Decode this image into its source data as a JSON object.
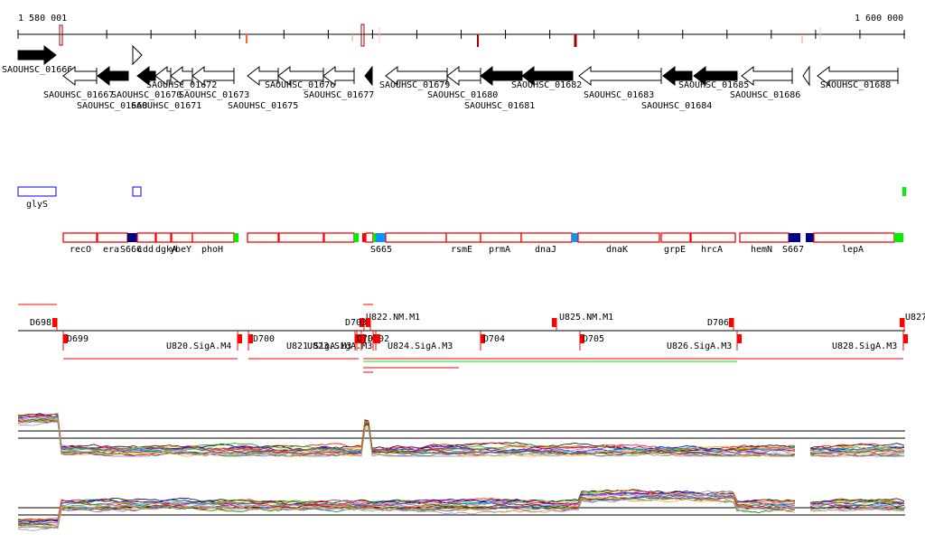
{
  "ruler": {
    "start_label": "1 580 001",
    "end_label": "1 600 000"
  },
  "genes": [
    "SAOUHSC_01666",
    "SAOUHSC_01667",
    "SAOUHSC_01668",
    "SAOUHSC_01670",
    "SAOUHSC_01671",
    "SAOUHSC_01672",
    "SAOUHSC_01673",
    "SAOUHSC_01675",
    "SAOUHSC_01676",
    "SAOUHSC_01677",
    "SAOUHSC_01679",
    "SAOUHSC_01680",
    "SAOUHSC_01681",
    "SAOUHSC_01682",
    "SAOUHSC_01683",
    "SAOUHSC_01684",
    "SAOUHSC_01685",
    "SAOUHSC_01686",
    "SAOUHSC_01688"
  ],
  "features": {
    "glys": "glyS"
  },
  "operons": [
    "recO",
    "era",
    "S666",
    "cdd",
    "dgkA",
    "ybeY",
    "phoH",
    "S665",
    "rsmE",
    "prmA",
    "dnaJ",
    "dnaK",
    "grpE",
    "hrcA",
    "hemN",
    "S667",
    "lepA"
  ],
  "promoters": [
    "D698",
    "U822.NM.M1",
    "D703",
    "U825.NM.M1",
    "D706",
    "U827",
    "D699",
    "U820.SigA.M4",
    "D700",
    "U821.SigA.M3",
    "U823.SigA.M3",
    "D701",
    "D702",
    "U824.SigA.M3",
    "D704",
    "D705",
    "U826.SigA.M3",
    "U828.SigA.M3"
  ],
  "colors": {
    "operon": "#ff0000",
    "start": "#00ee00",
    "srna": "#000088",
    "blue": "#0099ff"
  }
}
